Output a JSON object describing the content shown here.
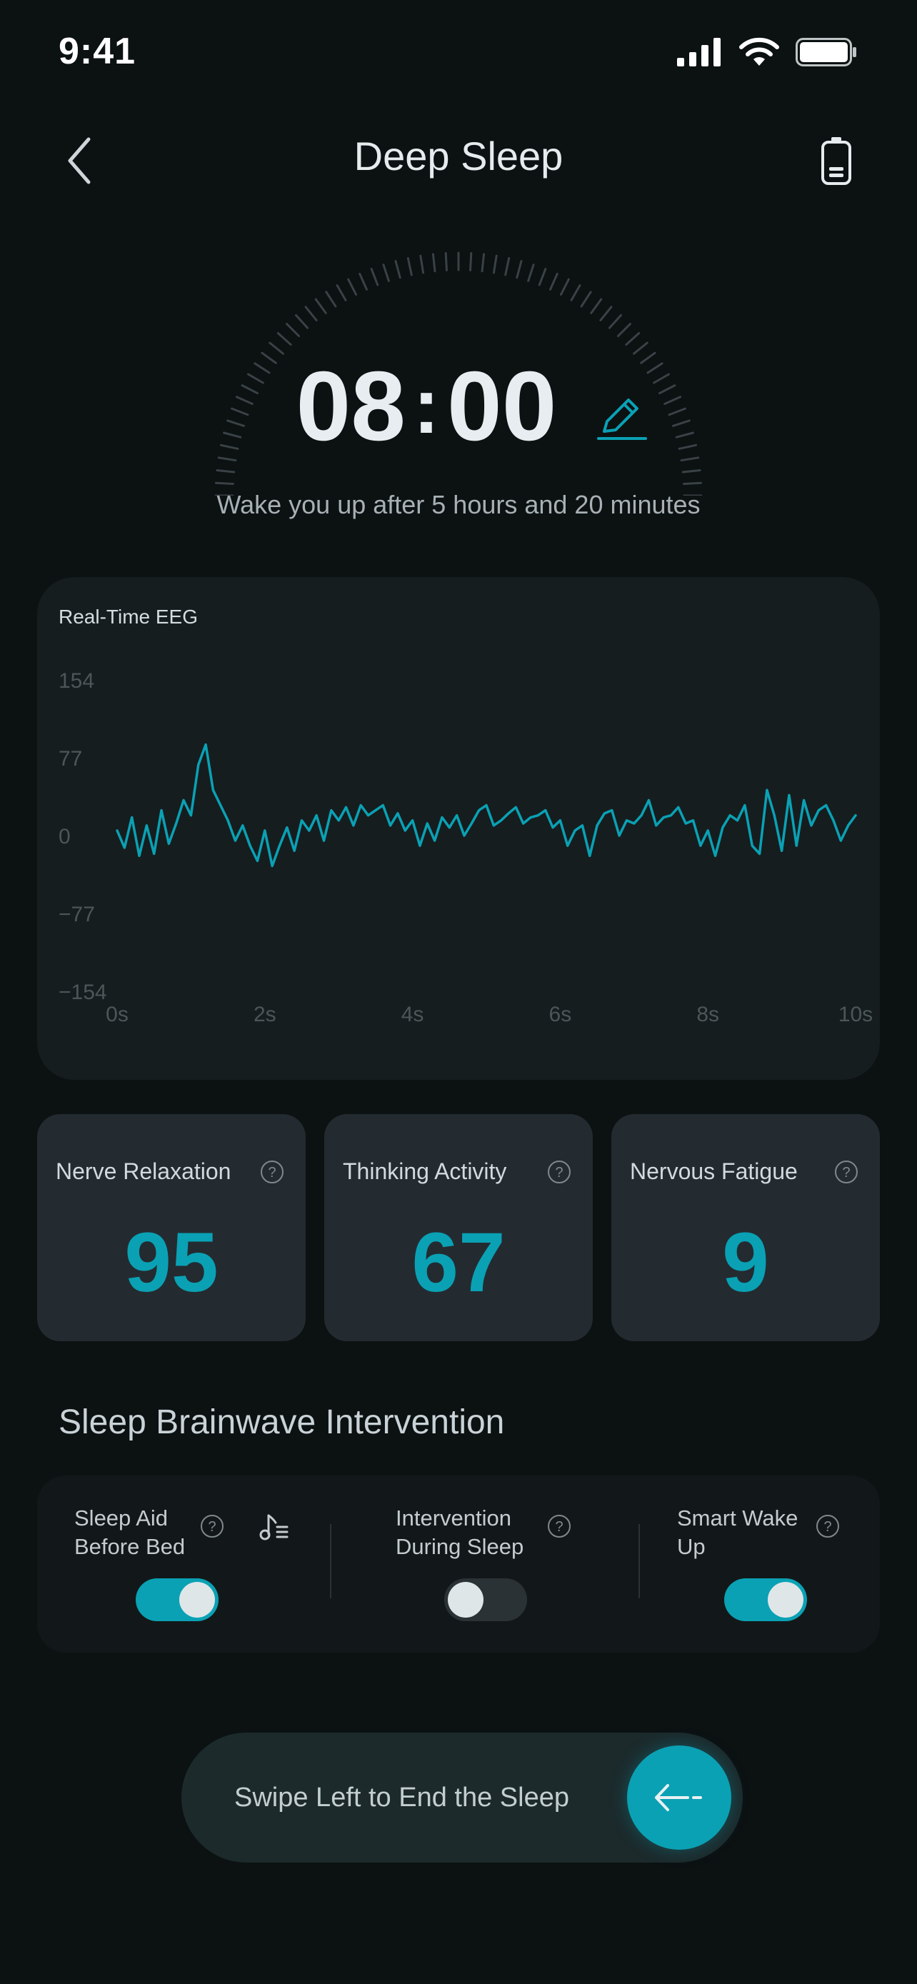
{
  "status_bar": {
    "time": "9:41"
  },
  "header": {
    "title": "Deep Sleep"
  },
  "alarm": {
    "hours": "08",
    "separator": ":",
    "minutes": "00",
    "message": "Wake you up after 5 hours and 20 minutes"
  },
  "eeg": {
    "title": "Real-Time EEG",
    "chart_data": {
      "type": "line",
      "title": "Real-Time EEG",
      "y_ticks": [
        "154",
        "77",
        "0",
        "−77",
        "−154"
      ],
      "x_ticks": [
        "0s",
        "2s",
        "4s",
        "6s",
        "8s",
        "10s"
      ],
      "xlim": [
        0,
        10
      ],
      "ylim": [
        -154,
        154
      ],
      "color": "#0aa1b4",
      "grid": false,
      "series": [
        {
          "x": [
            0,
            0.1,
            0.2,
            0.3,
            0.4,
            0.5,
            0.6,
            0.7,
            0.8,
            0.9,
            1.0,
            1.1,
            1.2,
            1.3,
            1.4,
            1.5,
            1.6,
            1.7,
            1.8,
            1.9,
            2.0,
            2.1,
            2.2,
            2.3,
            2.4,
            2.5,
            2.6,
            2.7,
            2.8,
            2.9,
            3.0,
            3.1,
            3.2,
            3.3,
            3.4,
            3.5,
            3.6,
            3.7,
            3.8,
            3.9,
            4.0,
            4.1,
            4.2,
            4.3,
            4.4,
            4.5,
            4.6,
            4.7,
            4.8,
            4.9,
            5.0,
            5.1,
            5.2,
            5.3,
            5.4,
            5.5,
            5.6,
            5.7,
            5.8,
            5.9,
            6.0,
            6.1,
            6.2,
            6.3,
            6.4,
            6.5,
            6.6,
            6.7,
            6.8,
            6.9,
            7.0,
            7.1,
            7.2,
            7.3,
            7.4,
            7.5,
            7.6,
            7.7,
            7.8,
            7.9,
            8.0,
            8.1,
            8.2,
            8.3,
            8.4,
            8.5,
            8.6,
            8.7,
            8.8,
            8.9,
            9.0,
            9.1,
            9.2,
            9.3,
            9.4,
            9.5,
            9.6,
            9.7,
            9.8,
            9.9,
            10.0
          ],
          "values": [
            5,
            -12,
            18,
            -20,
            10,
            -18,
            25,
            -8,
            12,
            35,
            20,
            70,
            90,
            45,
            30,
            15,
            -5,
            10,
            -10,
            -25,
            5,
            -30,
            -10,
            8,
            -15,
            15,
            5,
            20,
            -5,
            25,
            15,
            28,
            10,
            30,
            20,
            25,
            30,
            10,
            22,
            5,
            15,
            -10,
            12,
            -5,
            18,
            8,
            20,
            0,
            12,
            25,
            30,
            10,
            15,
            22,
            28,
            12,
            18,
            20,
            25,
            8,
            15,
            -10,
            5,
            10,
            -20,
            10,
            22,
            25,
            0,
            15,
            12,
            20,
            35,
            10,
            18,
            20,
            28,
            12,
            15,
            -10,
            5,
            -20,
            8,
            20,
            15,
            30,
            -10,
            -18,
            45,
            20,
            -15,
            40,
            -10,
            35,
            10,
            25,
            30,
            15,
            -5,
            10,
            20
          ]
        }
      ]
    }
  },
  "metrics": [
    {
      "label": "Nerve Relaxation",
      "value": "95"
    },
    {
      "label": "Thinking Activity",
      "value": "67"
    },
    {
      "label": "Nervous Fatigue",
      "value": "9"
    }
  ],
  "intervention": {
    "title": "Sleep Brainwave Intervention",
    "items": [
      {
        "label_line1": "Sleep Aid",
        "label_line2": "Before Bed",
        "enabled": true
      },
      {
        "label_line1": "Intervention",
        "label_line2": "During Sleep",
        "enabled": false
      },
      {
        "label_line1": "Smart Wake",
        "label_line2": "Up",
        "enabled": true
      }
    ]
  },
  "swipe": {
    "label": "Swipe Left to End the Sleep"
  },
  "icons": {
    "signal": "signal-icon",
    "wifi": "wifi-icon",
    "battery": "battery-icon",
    "back": "chevron-left-icon",
    "device_battery": "device-battery-icon",
    "edit": "pencil-icon",
    "help": "question-circle-icon",
    "music": "music-list-icon",
    "swipe": "arrow-left-icon"
  }
}
